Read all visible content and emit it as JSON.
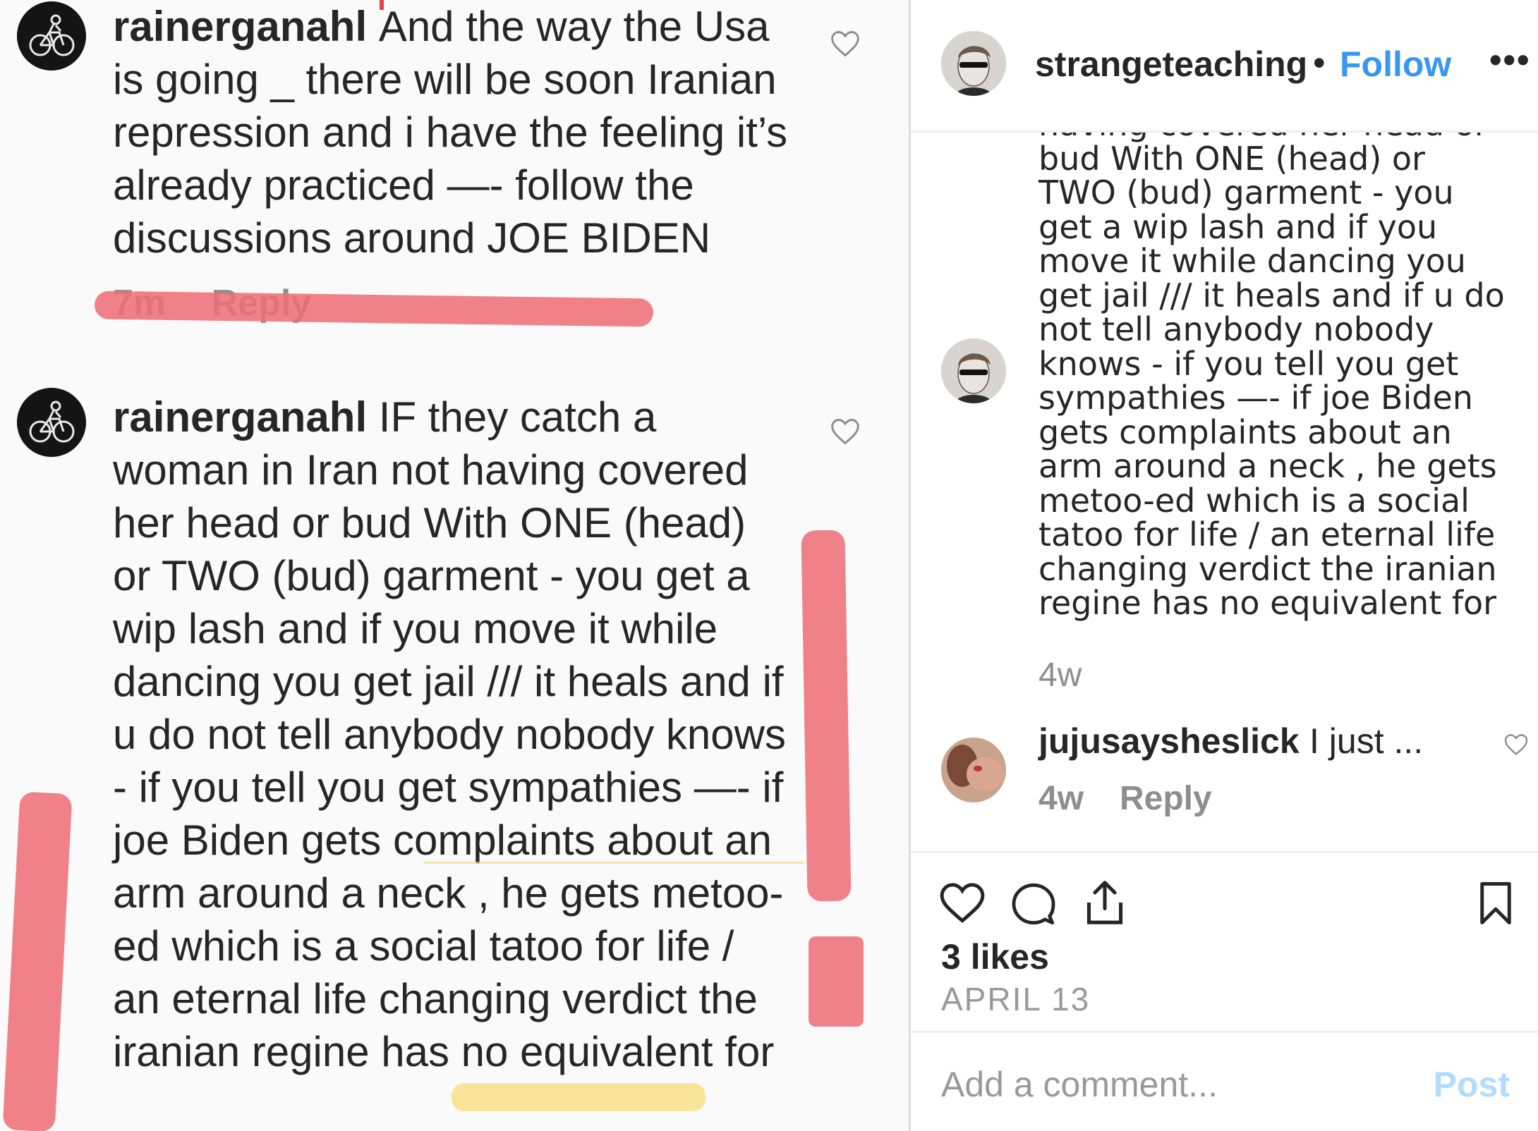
{
  "left_panel": {
    "comment1": {
      "username": "rainerganahl",
      "text": "And the way the Usa is going _ there will be soon Iranian repression and i have the feeling it’s already practiced —- follow the discussions around JOE BIDEN",
      "time": "7m",
      "reply_label": "Reply"
    },
    "comment2": {
      "username": "rainerganahl",
      "text": "IF they catch a woman in Iran  not having covered her head or bud With ONE (head) or TWO (bud) garment - you get a wip lash and if you move it while dancing you get jail /// it heals and if u do not tell anybody nobody knows - if you tell you get sympathies —- if joe Biden gets complaints about an arm around a neck , he gets metoo-ed which is a social tatoo for life / an eternal life changing verdict the iranian regine has no equivalent for"
    }
  },
  "right_panel": {
    "header": {
      "username": "strangeteaching",
      "dot": "•",
      "follow_label": "Follow",
      "more_label": "•••"
    },
    "caption_lines": [
      "naving covered her head or",
      "bud With ONE (head) or",
      "TWO (bud) garment - you",
      "get a wip lash and if you",
      "move it while dancing you",
      "get jail /// it heals and if u do",
      "not tell anybody nobody",
      "knows - if you tell you get",
      "sympathies —- if joe Biden",
      "gets complaints about an",
      "arm around a neck , he gets",
      "metoo-ed which is a social",
      "tatoo for life / an eternal life",
      "changing verdict the iranian",
      "regine has no equivalent for"
    ],
    "caption_time": "4w",
    "comment": {
      "username": "jujusaysheslick",
      "text": "I just ...",
      "time": "4w",
      "reply_label": "Reply"
    },
    "likes": "3 likes",
    "date": "APRIL 13",
    "add_comment_placeholder": "Add a comment...",
    "post_label": "Post"
  },
  "colors": {
    "link_blue": "#3897f0",
    "post_disabled": "#b3dbff",
    "marker_red": "#ee6f78",
    "marker_yellow": "#f8dc7a"
  }
}
